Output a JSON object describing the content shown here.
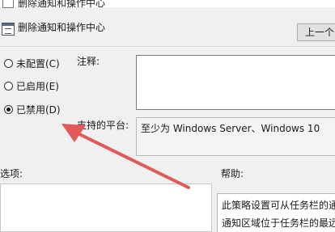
{
  "window": {
    "title_partial": "删除通知和操作中心"
  },
  "header": {
    "icon": "policy-setting-icon",
    "title": "删除通知和操作中心",
    "prev_button": "上一个"
  },
  "state": {
    "options": [
      {
        "label": "未配置(C)",
        "selected": false
      },
      {
        "label": "已启用(E)",
        "selected": false
      },
      {
        "label": "已禁用(D)",
        "selected": true
      }
    ]
  },
  "fields": {
    "comment_label": "注释:",
    "comment_value": "",
    "platform_label": "支持的平台:",
    "platform_value": "至少为 Windows Server、Windows 10"
  },
  "sections": {
    "options_label": "选项:",
    "help_label": "帮助:",
    "help_lines": [
      "此策略设置可从任务栏的通",
      "通知区域位于任务栏的最远"
    ]
  },
  "annotation": {
    "arrow_color": "#e05a5a",
    "arrow_target": "已禁用(D)"
  }
}
